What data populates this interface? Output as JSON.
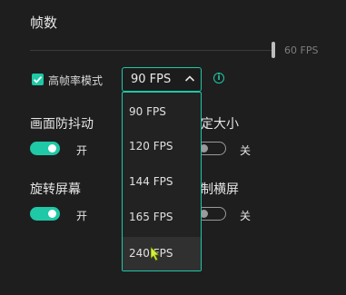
{
  "frame_rate": {
    "title": "帧数",
    "slider_value_label": "60 FPS",
    "slider_level_fraction": 1.0
  },
  "high_fps_mode": {
    "label": "高帧率模式",
    "checked": true,
    "selected_value": "90 FPS",
    "info_glyph": "i"
  },
  "dropdown": {
    "options": [
      "90 FPS",
      "120 FPS",
      "144 FPS",
      "165 FPS",
      "240 FPS"
    ],
    "hovered_index": 4
  },
  "settings": {
    "anti_shake": {
      "label": "画面防抖动",
      "state_text": "开",
      "on": true
    },
    "fixed_size": {
      "label": "固定大小",
      "state_text": "关",
      "on": false
    },
    "rotate_screen": {
      "label": "旋转屏幕",
      "state_text": "开",
      "on": true
    },
    "force_landscape": {
      "label": "强制横屏",
      "state_text": "关",
      "on": false
    }
  },
  "colors": {
    "accent": "#1fc8a6",
    "background": "#1e1e1f"
  }
}
